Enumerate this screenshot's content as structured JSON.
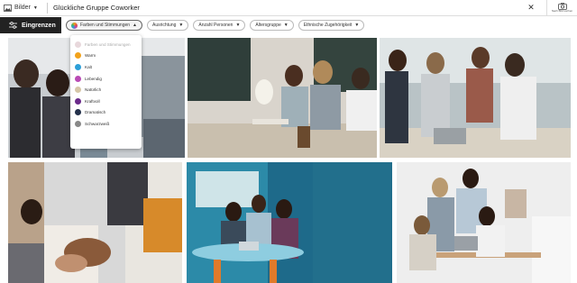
{
  "search": {
    "scope_label": "Bilder",
    "query": "Glückliche Gruppe Coworker",
    "clear_icon": "close-icon",
    "visual_search_label": "Nach Bild suchen"
  },
  "filters": {
    "narrow_label": "Eingrenzen",
    "chips": [
      {
        "label": "Farben und Stimmungen",
        "open": true
      },
      {
        "label": "Ausrichtung"
      },
      {
        "label": "Anzahl Personen"
      },
      {
        "label": "Altersgruppe"
      },
      {
        "label": "Ethnische Zugehörigkeit"
      }
    ]
  },
  "color_menu": {
    "options": [
      {
        "label": "Farben und Stimmungen",
        "color": "#e8d8dc"
      },
      {
        "label": "Warm",
        "color": "#f2a21b"
      },
      {
        "label": "Kalt",
        "color": "#2d9fd8"
      },
      {
        "label": "Lebendig",
        "color": "#b94bb5"
      },
      {
        "label": "Natürlich",
        "color": "#d6c7a8"
      },
      {
        "label": "Kraftvoll",
        "color": "#6a2a8a"
      },
      {
        "label": "Dramatisch",
        "color": "#23304a"
      },
      {
        "label": "Schwarzweiß",
        "color": "#888888"
      }
    ]
  },
  "colors": {
    "accent_dark": "#222222"
  }
}
